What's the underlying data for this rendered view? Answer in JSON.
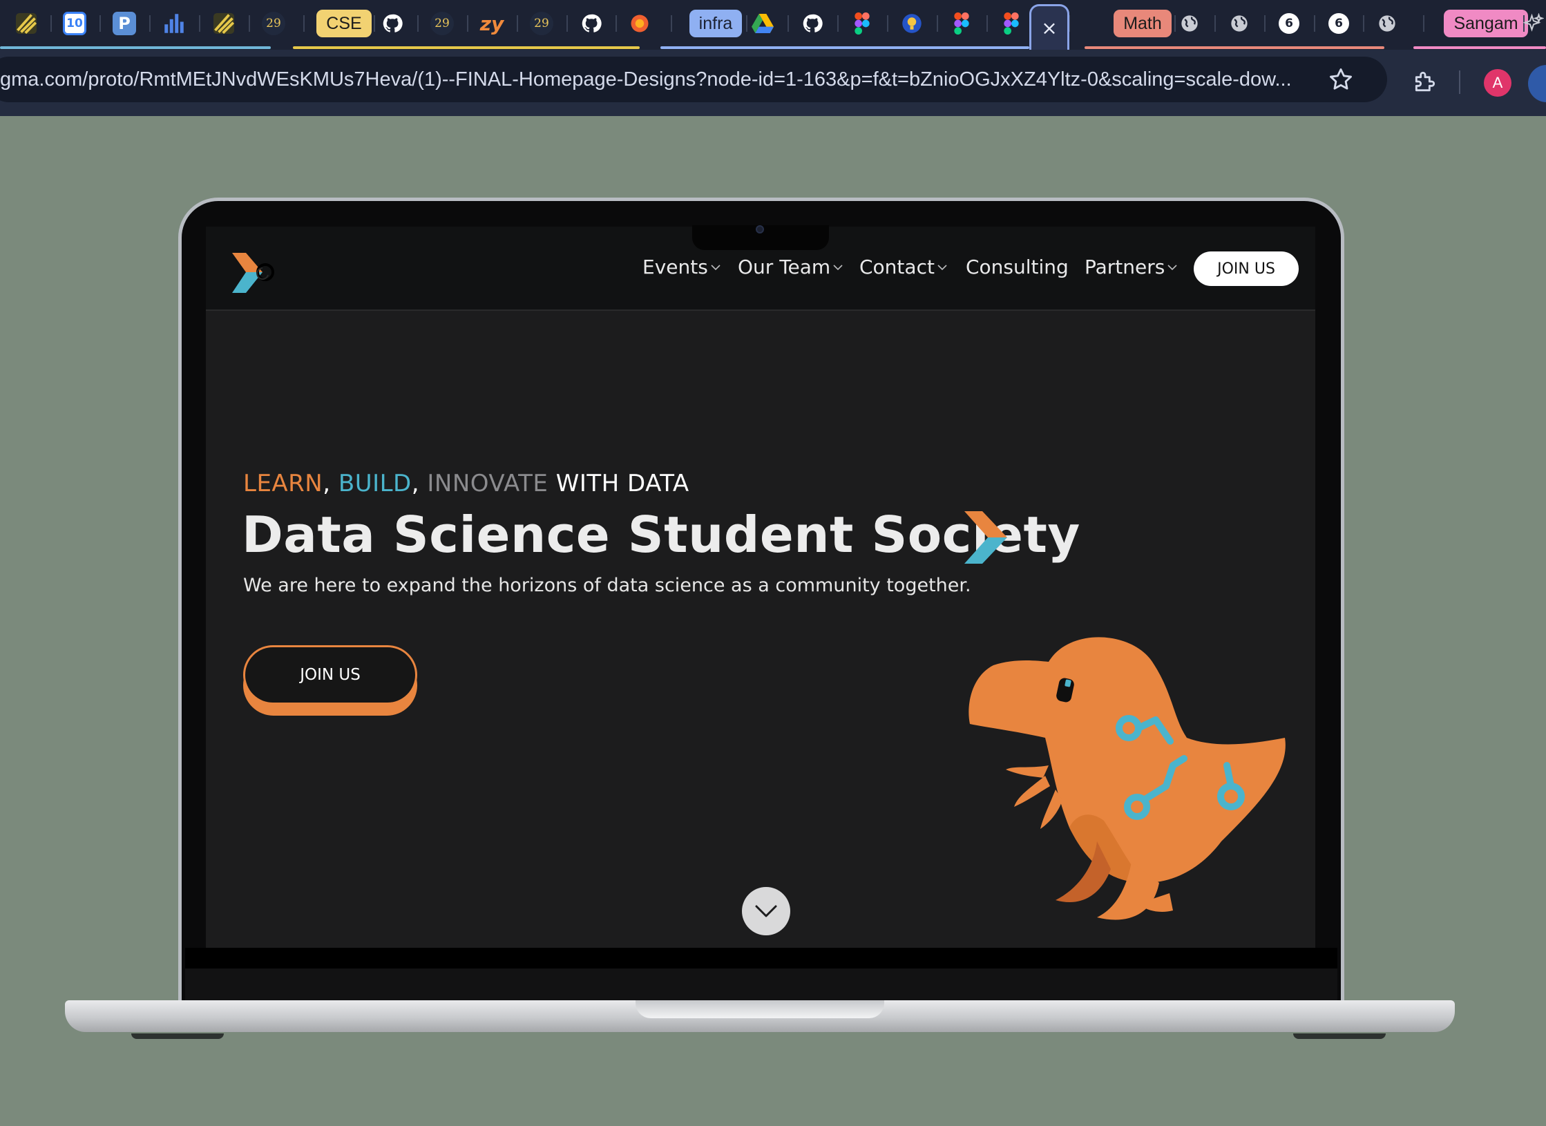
{
  "browser": {
    "tabs": [
      {
        "kind": "favicon",
        "icon": "stripes-icon",
        "color": "#e6c84a"
      },
      {
        "kind": "favicon",
        "icon": "calendar-icon",
        "text": "10",
        "color": "#3b82f6"
      },
      {
        "kind": "favicon",
        "icon": "p-icon",
        "text": "P",
        "color": "#5b8fd6"
      },
      {
        "kind": "favicon",
        "icon": "bar-chart-icon",
        "color": "#4f83e6"
      },
      {
        "kind": "favicon",
        "icon": "stripes-icon",
        "color": "#e6c84a"
      },
      {
        "kind": "favicon",
        "icon": "badge-29-icon",
        "text": "29",
        "color": "#e8c45a"
      },
      {
        "kind": "pill",
        "label": "CSE",
        "bg": "#f2d272",
        "fg": "#1c1c1c"
      },
      {
        "kind": "favicon",
        "icon": "github-icon",
        "color": "#ffffff"
      },
      {
        "kind": "favicon",
        "icon": "badge-29-icon",
        "text": "29",
        "color": "#e8c45a"
      },
      {
        "kind": "favicon",
        "icon": "zy-icon",
        "text": "zy",
        "color": "#f08a3c"
      },
      {
        "kind": "favicon",
        "icon": "badge-29-icon",
        "text": "29",
        "color": "#e8c45a"
      },
      {
        "kind": "favicon",
        "icon": "github-icon",
        "color": "#ffffff"
      },
      {
        "kind": "favicon",
        "icon": "flower-icon",
        "color": "#f06030"
      },
      {
        "kind": "pill",
        "label": "infra",
        "bg": "#8fb0f2",
        "fg": "#1c2233"
      },
      {
        "kind": "favicon",
        "icon": "drive-icon",
        "color": "#34a853"
      },
      {
        "kind": "favicon",
        "icon": "github-icon",
        "color": "#ffffff"
      },
      {
        "kind": "favicon",
        "icon": "figma-icon",
        "color": "#f24e1e"
      },
      {
        "kind": "favicon",
        "icon": "bulb-icon",
        "color": "#f5c542"
      },
      {
        "kind": "favicon",
        "icon": "figma-icon",
        "color": "#f24e1e"
      },
      {
        "kind": "favicon",
        "icon": "figma-icon",
        "color": "#f24e1e"
      },
      {
        "kind": "pill",
        "label": "Math",
        "bg": "#e8887a",
        "fg": "#1c1c1c"
      },
      {
        "kind": "favicon",
        "icon": "globe-icon",
        "color": "#c9ccd4"
      },
      {
        "kind": "favicon",
        "icon": "globe-icon",
        "color": "#c9ccd4"
      },
      {
        "kind": "favicon",
        "icon": "six-icon",
        "text": "6",
        "color": "#ffffff"
      },
      {
        "kind": "favicon",
        "icon": "six-icon",
        "text": "6",
        "color": "#ffffff"
      },
      {
        "kind": "favicon",
        "icon": "globe-icon",
        "color": "#c9ccd4"
      },
      {
        "kind": "pill",
        "label": "Sangam",
        "bg": "#f08ac4",
        "fg": "#1c1c1c"
      },
      {
        "kind": "favicon",
        "icon": "sparkle-icon",
        "color": "#c9ccd4"
      }
    ],
    "active_tab_close": "×",
    "url": "gma.com/proto/RmtMEtJNvdWEsKMUs7Heva/(1)--FINAL-Homepage-Designs?node-id=1-163&p=f&t=bZnioOGJxXZ4Yltz-0&scaling=scale-dow...",
    "avatar_letter": "A"
  },
  "site": {
    "nav": {
      "items": [
        {
          "label": "Events",
          "has_dropdown": true
        },
        {
          "label": "Our Team",
          "has_dropdown": true
        },
        {
          "label": "Contact",
          "has_dropdown": true
        },
        {
          "label": "Consulting",
          "has_dropdown": false
        },
        {
          "label": "Partners",
          "has_dropdown": true
        }
      ],
      "join_label": "JOIN US"
    },
    "hero": {
      "tag_word_1": "LEARN",
      "tag_sep_1": ", ",
      "tag_word_2": "BUILD",
      "tag_sep_2": ", ",
      "tag_word_3": "INNOVATE",
      "tag_word_4": " WITH DATA",
      "title": "Data Science Student Society",
      "subtitle": "We are here to expand the horizons of data science as a community together.",
      "join_label": "JOIN US"
    },
    "colors": {
      "orange": "#e8853f",
      "blue": "#4bb4cc",
      "gray": "#8b8b8e",
      "bg": "#1c1c1d"
    }
  }
}
